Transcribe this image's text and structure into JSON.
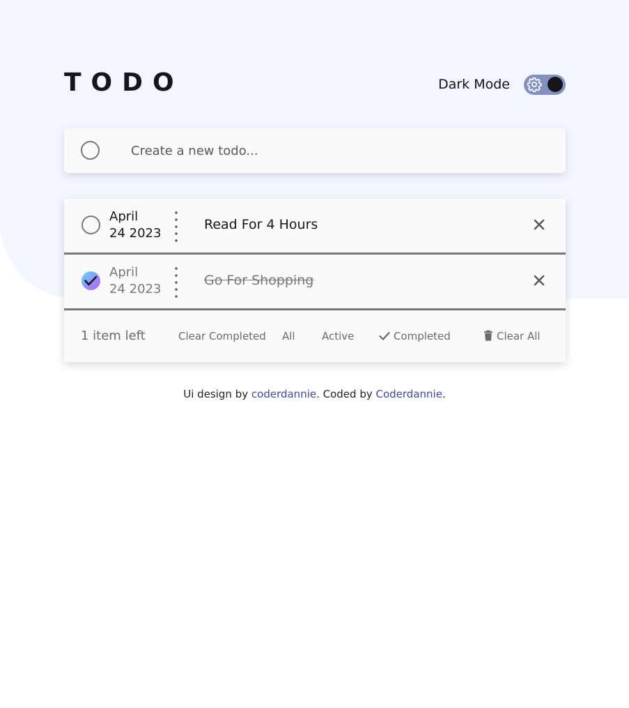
{
  "header": {
    "title": "TODO",
    "dark_mode_label": "Dark Mode"
  },
  "new_todo": {
    "placeholder": "Create a new todo...",
    "value": ""
  },
  "todos": [
    {
      "date_month": "April",
      "date_day_year": "24 2023",
      "text": "Read For 4 Hours",
      "completed": false
    },
    {
      "date_month": "April",
      "date_day_year": "24 2023",
      "text": "Go For Shopping",
      "completed": true
    }
  ],
  "footer": {
    "items_left": "1 item left",
    "clear_completed": "Clear Completed",
    "filter_all": "All",
    "filter_active": "Active",
    "filter_completed": "Completed",
    "clear_all": "Clear All"
  },
  "attribution": {
    "prefix": "Ui design by ",
    "designer": "coderdannie",
    "middle": ". Coded by ",
    "coder": "Coderdannie",
    "suffix": "."
  },
  "colors": {
    "background_shape": "#f2f6fe",
    "toggle_track": "#8391c2",
    "check_gradient_start": "#57ddff",
    "check_gradient_end": "#c058f3",
    "link": "#3a4a9c"
  },
  "icons": {
    "toggle_icon": "gear-icon",
    "delete_icon": "close-icon",
    "completed_filter_icon": "check-icon",
    "clear_all_icon": "trash-icon"
  }
}
